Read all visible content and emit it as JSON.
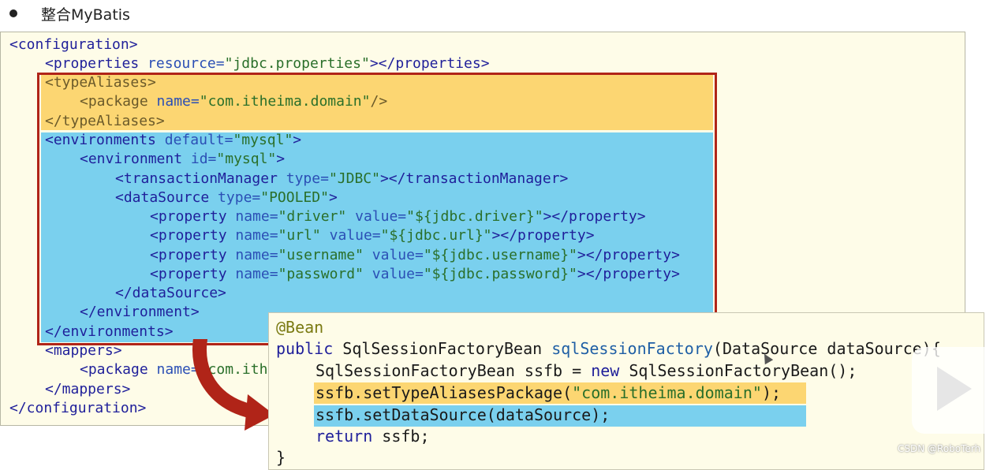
{
  "heading": {
    "text": "整合MyBatis"
  },
  "xml": {
    "lines": [
      [
        {
          "t": "<configuration>",
          "c": "tag"
        }
      ],
      [
        {
          "t": "<properties",
          "c": "tag"
        },
        {
          "t": " resource=",
          "c": "attr"
        },
        {
          "t": "\"jdbc.properties\"",
          "c": "val"
        },
        {
          "t": "></properties>",
          "c": "tag"
        }
      ],
      [
        {
          "t": "<typeAliases>",
          "c": "tag muted"
        }
      ],
      [
        {
          "t": "<package",
          "c": "tag muted"
        },
        {
          "t": " name=",
          "c": "attr"
        },
        {
          "t": "\"com.itheima.domain\"",
          "c": "val"
        },
        {
          "t": "/>",
          "c": "tag muted"
        }
      ],
      [
        {
          "t": "</typeAliases>",
          "c": "tag muted"
        }
      ],
      [
        {
          "t": "<environments",
          "c": "tag"
        },
        {
          "t": " default=",
          "c": "attr"
        },
        {
          "t": "\"mysql\"",
          "c": "val"
        },
        {
          "t": ">",
          "c": "tag"
        }
      ],
      [
        {
          "t": "<environment",
          "c": "tag"
        },
        {
          "t": " id=",
          "c": "attr"
        },
        {
          "t": "\"mysql\"",
          "c": "val"
        },
        {
          "t": ">",
          "c": "tag"
        }
      ],
      [
        {
          "t": "<transactionManager",
          "c": "tag"
        },
        {
          "t": " type=",
          "c": "attr"
        },
        {
          "t": "\"JDBC\"",
          "c": "val"
        },
        {
          "t": "></transactionManager>",
          "c": "tag"
        }
      ],
      [
        {
          "t": "<dataSource",
          "c": "tag"
        },
        {
          "t": " type=",
          "c": "attr"
        },
        {
          "t": "\"POOLED\"",
          "c": "val"
        },
        {
          "t": ">",
          "c": "tag"
        }
      ],
      [
        {
          "t": "<property",
          "c": "tag"
        },
        {
          "t": " name=",
          "c": "attr"
        },
        {
          "t": "\"driver\"",
          "c": "val"
        },
        {
          "t": " value=",
          "c": "attr"
        },
        {
          "t": "\"${jdbc.driver}\"",
          "c": "val"
        },
        {
          "t": "></property>",
          "c": "tag"
        }
      ],
      [
        {
          "t": "<property",
          "c": "tag"
        },
        {
          "t": " name=",
          "c": "attr"
        },
        {
          "t": "\"url\"",
          "c": "val"
        },
        {
          "t": " value=",
          "c": "attr"
        },
        {
          "t": "\"${jdbc.url}\"",
          "c": "val"
        },
        {
          "t": "></property>",
          "c": "tag"
        }
      ],
      [
        {
          "t": "<property",
          "c": "tag"
        },
        {
          "t": " name=",
          "c": "attr"
        },
        {
          "t": "\"username\"",
          "c": "val"
        },
        {
          "t": " value=",
          "c": "attr"
        },
        {
          "t": "\"${jdbc.username}\"",
          "c": "val"
        },
        {
          "t": "></property>",
          "c": "tag"
        }
      ],
      [
        {
          "t": "<property",
          "c": "tag"
        },
        {
          "t": " name=",
          "c": "attr"
        },
        {
          "t": "\"password\"",
          "c": "val"
        },
        {
          "t": " value=",
          "c": "attr"
        },
        {
          "t": "\"${jdbc.password}\"",
          "c": "val"
        },
        {
          "t": "></property>",
          "c": "tag"
        }
      ],
      [
        {
          "t": "</dataSource>",
          "c": "tag"
        }
      ],
      [
        {
          "t": "</environment>",
          "c": "tag"
        }
      ],
      [
        {
          "t": "</environments>",
          "c": "tag"
        }
      ],
      [
        {
          "t": "<mappers>",
          "c": "tag"
        }
      ],
      [
        {
          "t": "<package",
          "c": "tag"
        },
        {
          "t": " name=",
          "c": "attr"
        },
        {
          "t": "\"com.ith",
          "c": "val"
        }
      ],
      [
        {
          "t": "</mappers>",
          "c": "tag"
        }
      ],
      [
        {
          "t": "</configuration>",
          "c": "tag"
        }
      ]
    ]
  },
  "java": {
    "lines": [
      [
        {
          "t": "@Bean",
          "c": "annot"
        }
      ],
      [
        {
          "t": "public",
          "c": "kw"
        },
        {
          "t": " SqlSessionFactoryBean ",
          "c": ""
        },
        {
          "t": "sqlSessionFactory",
          "c": "meth"
        },
        {
          "t": "(DataSource dataSource){",
          "c": ""
        }
      ],
      [
        {
          "t": "SqlSessionFactoryBean ssfb = ",
          "c": ""
        },
        {
          "t": "new",
          "c": "kw"
        },
        {
          "t": " SqlSessionFactoryBean();",
          "c": ""
        }
      ],
      [
        {
          "t": "ssfb.setTypeAliasesPackage(",
          "c": ""
        },
        {
          "t": "\"com.itheima.domain\"",
          "c": "str"
        },
        {
          "t": ");",
          "c": ""
        }
      ],
      [
        {
          "t": "ssfb.setDataSource(dataSource);",
          "c": ""
        }
      ],
      [
        {
          "t": "return",
          "c": "kw"
        },
        {
          "t": " ssfb;",
          "c": ""
        }
      ],
      [
        {
          "t": "}",
          "c": ""
        }
      ]
    ]
  },
  "watermark": {
    "text": "CSDN @RoboTerh"
  },
  "colors": {
    "highlight_yellow": "#fcd672",
    "highlight_blue": "#7ad0ee",
    "frame_red": "#b02418"
  }
}
